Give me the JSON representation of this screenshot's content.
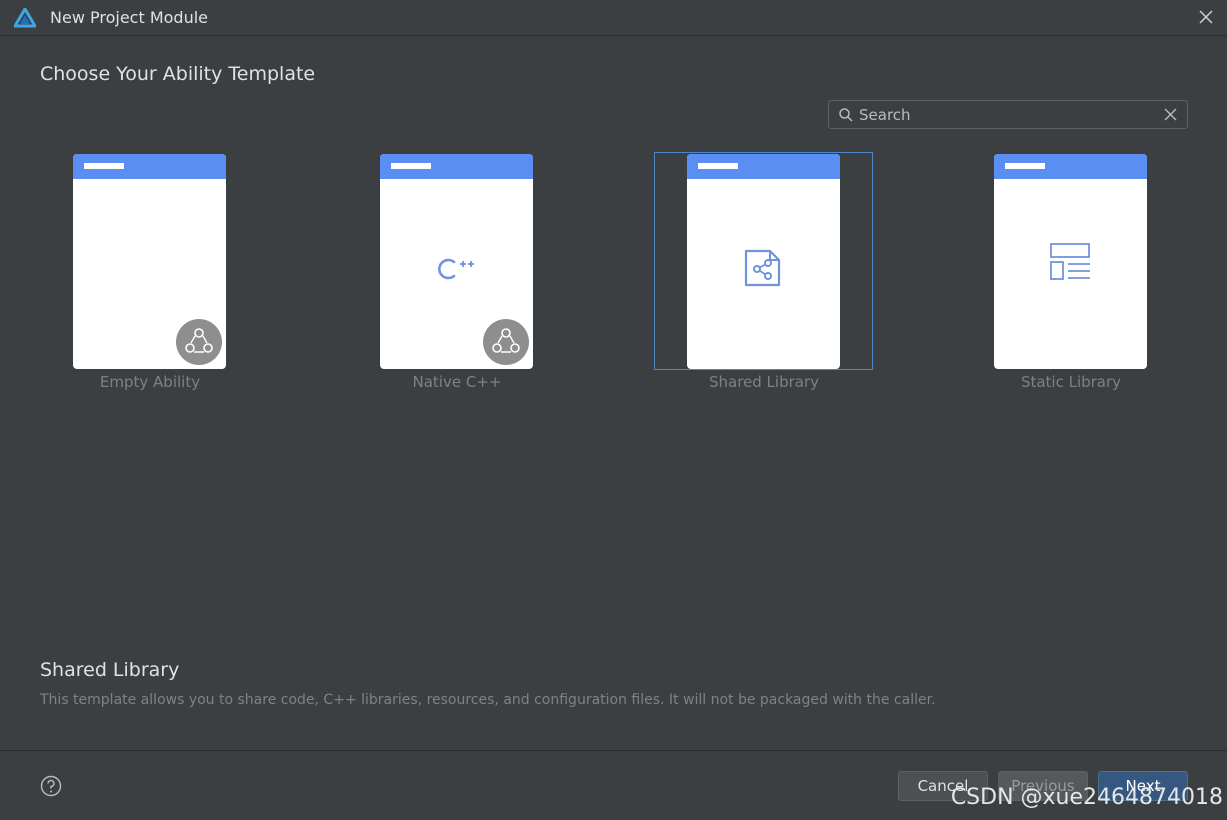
{
  "window": {
    "title": "New Project Module"
  },
  "heading": "Choose Your Ability Template",
  "search": {
    "placeholder": "Search",
    "value": ""
  },
  "templates": [
    {
      "label": "Empty Ability",
      "icon": "harmony-badge-icon"
    },
    {
      "label": "Native C++",
      "icon": "cpp-icon"
    },
    {
      "label": "Shared Library",
      "icon": "share-file-icon",
      "selected": true
    },
    {
      "label": "Static Library",
      "icon": "layout-list-icon"
    }
  ],
  "description": {
    "title": "Shared Library",
    "text": "This template allows you to share code, C++ libraries, resources, and configuration files. It will not be packaged with the caller."
  },
  "buttons": {
    "cancel": "Cancel",
    "previous": "Previous",
    "next": "Next"
  },
  "watermark": "CSDN @xue2464874018",
  "colors": {
    "accent": "#5b8ef2",
    "selection": "#4a88c7",
    "primary_button": "#365880"
  }
}
